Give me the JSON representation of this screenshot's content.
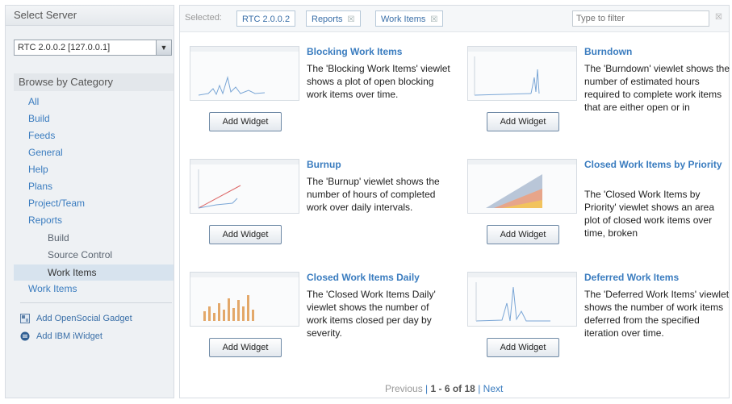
{
  "sidebar": {
    "title": "Select Server",
    "server": "RTC 2.0.0.2 [127.0.0.1]",
    "browse_title": "Browse by Category",
    "categories": [
      {
        "label": "All"
      },
      {
        "label": "Build"
      },
      {
        "label": "Feeds"
      },
      {
        "label": "General"
      },
      {
        "label": "Help"
      },
      {
        "label": "Plans"
      },
      {
        "label": "Project/Team"
      },
      {
        "label": "Reports"
      },
      {
        "label": "Build"
      },
      {
        "label": "Source Control"
      },
      {
        "label": "Work Items"
      },
      {
        "label": "Work Items"
      }
    ],
    "add_opensocial": "Add OpenSocial Gadget",
    "add_ibm": "Add IBM iWidget"
  },
  "topbar": {
    "selected_label": "Selected:",
    "chips": [
      "RTC 2.0.0.2",
      "Reports",
      "Work Items"
    ],
    "chip_close": "☒",
    "filter_placeholder": "Type to filter",
    "filter_close": "☒"
  },
  "widgets": [
    {
      "title": "Blocking Work Items",
      "desc": "The 'Blocking Work Items' viewlet shows a plot of open blocking work items over time.",
      "button": "Add Widget"
    },
    {
      "title": "Burndown",
      "desc": "The 'Burndown' viewlet shows the number of estimated hours required to complete work items that are either open or in",
      "button": "Add Widget"
    },
    {
      "title": "Burnup",
      "desc": "The 'Burnup' viewlet shows the number of hours of completed work over daily intervals.",
      "button": "Add Widget"
    },
    {
      "title": "Closed Work Items by Priority",
      "desc": "The 'Closed Work Items by Priority' viewlet shows an area plot of closed work items over time, broken",
      "button": "Add Widget"
    },
    {
      "title": "Closed Work Items Daily",
      "desc": "The 'Closed Work Items Daily' viewlet shows the number of work items closed per day by severity.",
      "button": "Add Widget"
    },
    {
      "title": "Deferred Work Items",
      "desc": "The 'Deferred Work Items' viewlet shows the number of work items deferred from the specified iteration over time.",
      "button": "Add Widget"
    }
  ],
  "pager": {
    "previous": "Previous",
    "separator": "|",
    "range": "1 - 6 of 18",
    "next": "Next"
  },
  "icons": {
    "opensocial": "opensocial-gadget-icon",
    "ibm": "ibm-widget-icon"
  },
  "colors": {
    "link": "#3a7cbf",
    "sidebar_bg": "#eef1f4",
    "selected_bg": "#d7e3ee"
  }
}
